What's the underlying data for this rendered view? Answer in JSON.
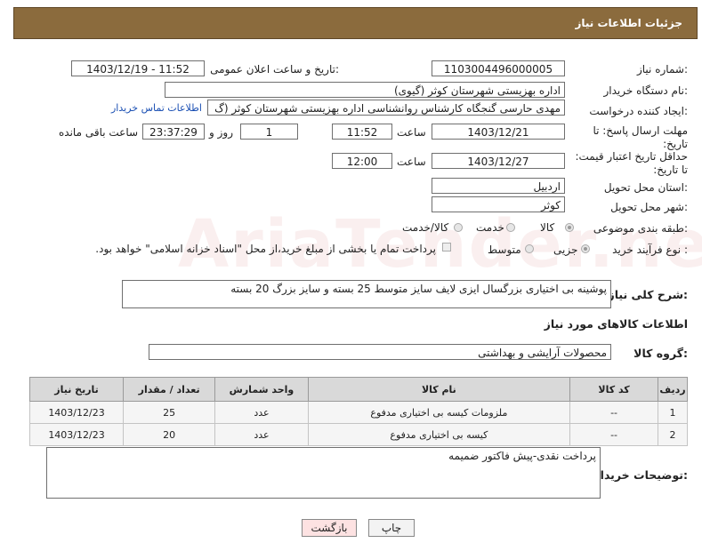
{
  "header": {
    "title": "جزئیات اطلاعات نیاز"
  },
  "fields": {
    "need_number_label": "شماره نیاز:",
    "need_number": "1103004496000005",
    "announce_label": "تاریخ و ساعت اعلان عمومی:",
    "announce_value": "1403/12/19 - 11:52",
    "buyer_org_label": "نام دستگاه خریدار:",
    "buyer_org": "اداره بهزیستی شهرستان کوثر (گیوی)",
    "creator_label": "ایجاد کننده درخواست:",
    "creator": "مهدی حارسی گنجگاه کارشناس روانشناسی اداره بهزیستی شهرستان کوثر (گ",
    "contact_link": "اطلاعات تماس خریدار",
    "deadline_label": "مهلت ارسال پاسخ: تا تاریخ:",
    "deadline_date": "1403/12/21",
    "time_label": "ساعت",
    "deadline_time": "11:52",
    "days_value": "1",
    "days_label": "روز و",
    "remaining_value": "23:37:29",
    "remaining_label": "ساعت باقی مانده",
    "validity_label": "حداقل تاریخ اعتبار قیمت: تا تاریخ:",
    "validity_date": "1403/12/27",
    "validity_time": "12:00",
    "province_label": "استان محل تحویل:",
    "province": "اردبیل",
    "city_label": "شهر محل تحویل:",
    "city": "کوثر",
    "category_label": "طبقه بندی موضوعی:",
    "category_options": [
      "کالا",
      "خدمت",
      "کالا/خدمت"
    ],
    "category_selected": "کالا",
    "process_label": "نوع فرآیند خرید :",
    "process_options": [
      "جزیی",
      "متوسط"
    ],
    "process_selected": "جزیی",
    "payment_note": "پرداخت تمام یا بخشی از مبلغ خرید،از محل \"اسناد خزانه اسلامی\" خواهد بود.",
    "description_label": "شرح کلی نیاز:",
    "description": "پوشینه بی اختیاری بزرگسال ایزی لایف سایز متوسط 25 بسته و سایز بزرگ 20 بسته",
    "goods_info_title": "اطلاعات کالاهای مورد نیاز",
    "goods_group_label": "گروه کالا:",
    "goods_group": "محصولات آرایشی و بهداشتی",
    "buyer_notes_label": "توضیحات خریدار:",
    "buyer_notes": "پرداخت نقدی-پیش فاکتور ضمیمه"
  },
  "table": {
    "headers": [
      "ردیف",
      "کد کالا",
      "نام کالا",
      "واحد شمارش",
      "تعداد / مقدار",
      "تاریخ نیاز"
    ],
    "rows": [
      [
        "1",
        "--",
        "ملزومات کیسه بی اختیاری مدفوع",
        "عدد",
        "25",
        "1403/12/23"
      ],
      [
        "2",
        "--",
        "کیسه بی اختیاری مدفوع",
        "عدد",
        "20",
        "1403/12/23"
      ]
    ]
  },
  "buttons": {
    "print": "چاپ",
    "back": "بازگشت"
  },
  "watermark": "AriaTender.neT",
  "colors": {
    "header_bg": "#8b6b3d",
    "link": "#1a4fb3",
    "back_button_bg": "#fde2e2"
  }
}
